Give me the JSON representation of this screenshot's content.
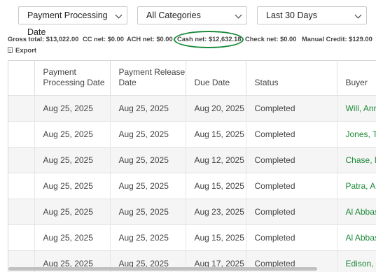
{
  "filters": {
    "date_type": "Payment Processing Date",
    "category": "All Categories",
    "range": "Last 30 Days"
  },
  "summary": {
    "gross": "Gross total: $13,022.00",
    "cc": "CC net: $0.00",
    "ach": "ACH net: $0.00",
    "cash": "Cash net: $12,632.18",
    "check": "Check net: $0.00",
    "manual": "Manual Credit: $129.00"
  },
  "export_label": "Export",
  "table": {
    "headers": [
      "Payment Processing Date",
      "Payment Release Date",
      "Due Date",
      "Status",
      "Buyer"
    ],
    "rows": [
      [
        "Aug 25, 2025",
        "Aug 25, 2025",
        "Aug 20, 2025",
        "Completed",
        "Will, Anna"
      ],
      [
        "Aug 25, 2025",
        "Aug 25, 2025",
        "Aug 15, 2025",
        "Completed",
        "Jones, Tim"
      ],
      [
        "Aug 25, 2025",
        "Aug 25, 2025",
        "Aug 12, 2025",
        "Completed",
        "Chase, Na"
      ],
      [
        "Aug 25, 2025",
        "Aug 25, 2025",
        "Aug 15, 2025",
        "Completed",
        "Patra, Ant"
      ],
      [
        "Aug 25, 2025",
        "Aug 25, 2025",
        "Aug 23, 2025",
        "Completed",
        "Al Abbas,"
      ],
      [
        "Aug 25, 2025",
        "Aug 25, 2025",
        "Aug 15, 2025",
        "Completed",
        "Al Abbas,"
      ],
      [
        "Aug 25, 2025",
        "Aug 25, 2025",
        "Aug 17, 2025",
        "Completed",
        "Edison, Cl"
      ]
    ]
  },
  "colors": {
    "buyer_link": "#1e8a3a",
    "highlight_circle": "#1a8b3c"
  }
}
